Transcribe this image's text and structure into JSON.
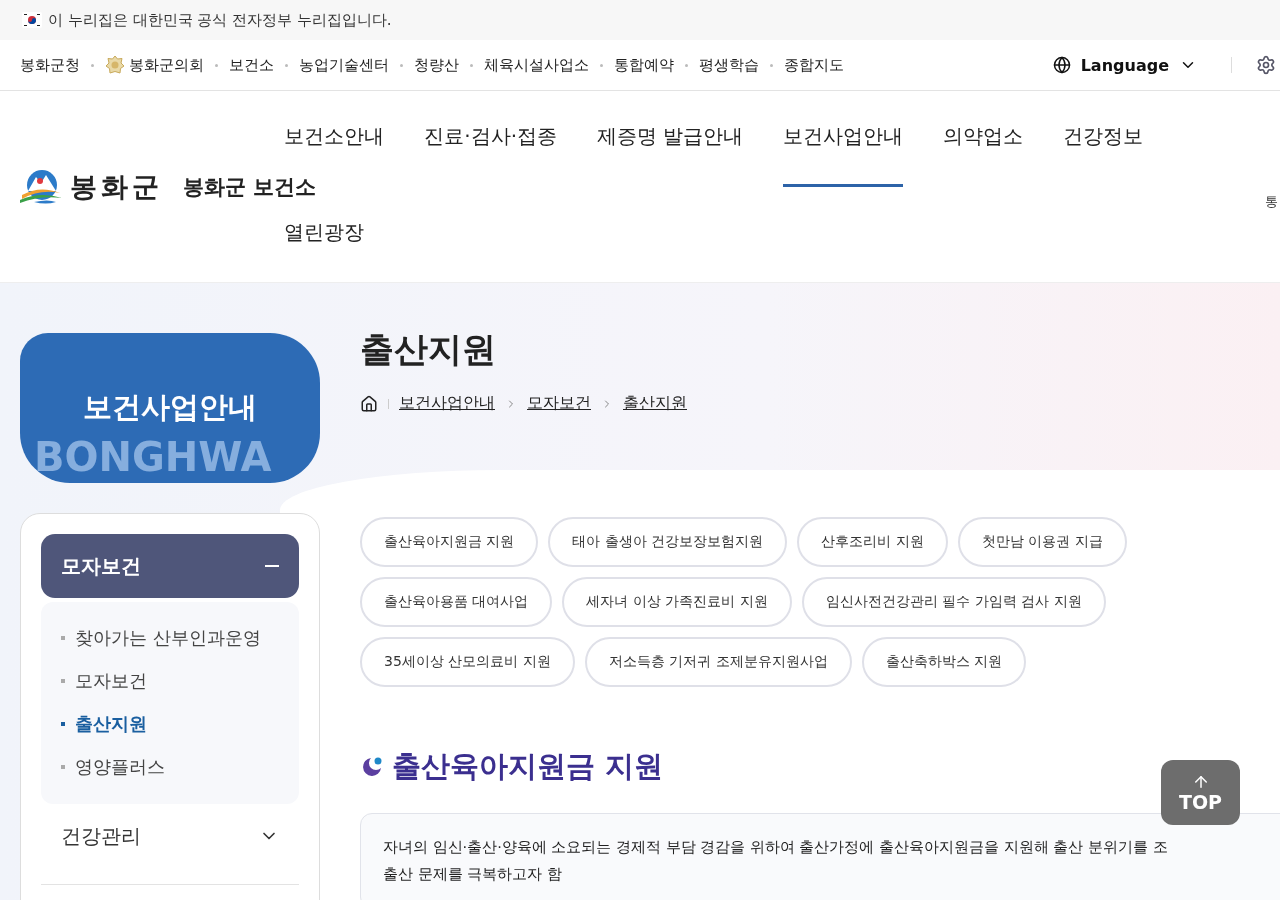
{
  "gov_banner": {
    "text": "이 누리집은 대한민국 공식 전자정부 누리집입니다."
  },
  "utility_nav": {
    "links": [
      {
        "label": "봉화군청",
        "kind": "text"
      },
      {
        "label": "봉화군의회",
        "kind": "emblem"
      },
      {
        "label": "보건소",
        "kind": "text"
      },
      {
        "label": "농업기술센터",
        "kind": "text"
      },
      {
        "label": "청량산",
        "kind": "text"
      },
      {
        "label": "체육시설사업소",
        "kind": "text"
      },
      {
        "label": "통합예약",
        "kind": "text"
      },
      {
        "label": "평생학습",
        "kind": "text"
      },
      {
        "label": "종합지도",
        "kind": "text"
      }
    ],
    "language": {
      "label": "Language"
    }
  },
  "header": {
    "logo_text": "봉화군",
    "site_name": "봉화군 보건소",
    "right_label": "통",
    "nav": [
      {
        "label": "보건소안내",
        "selected": false
      },
      {
        "label": "진료·검사·접종",
        "selected": false
      },
      {
        "label": "제증명 발급안내",
        "selected": false
      },
      {
        "label": "보건사업안내",
        "selected": true
      },
      {
        "label": "의약업소",
        "selected": false
      },
      {
        "label": "건강정보",
        "selected": false
      },
      {
        "label": "열린광장",
        "selected": false
      }
    ]
  },
  "sidebar": {
    "title": "보건사업안내",
    "background_text": "BONGHWA",
    "groups": [
      {
        "label": "모자보건",
        "expanded": true,
        "children": [
          {
            "label": "찾아가는 산부인과운영",
            "selected": false
          },
          {
            "label": "모자보건",
            "selected": false
          },
          {
            "label": "출산지원",
            "selected": true
          },
          {
            "label": "영양플러스",
            "selected": false
          }
        ]
      },
      {
        "label": "건강관리",
        "expanded": false
      }
    ]
  },
  "page": {
    "title": "출산지원",
    "breadcrumb": [
      "보건사업안내",
      "모자보건",
      "출산지원"
    ],
    "chips": [
      {
        "label": "출산육아지원금 지원"
      },
      {
        "label": "태아 출생아 건강보장보험지원"
      },
      {
        "label": "산후조리비 지원"
      },
      {
        "label": "첫만남 이용권 지급"
      },
      {
        "label": "출산육아용품 대여사업"
      },
      {
        "label": "세자녀 이상 가족진료비 지원"
      },
      {
        "label": "임신사전건강관리 필수 가임력 검사 지원"
      },
      {
        "label": "35세이상 산모의료비 지원"
      },
      {
        "label": "저소득층 기저귀 조제분유지원사업"
      },
      {
        "label": "출산축하박스 지원"
      }
    ],
    "section_title": "출산육아지원금 지원",
    "description": [
      "자녀의 임신·출산·양육에 소요되는 경제적 부담 경감을 위하여 출산가정에 출산육아지원금을 지원해 출산 분위기를 조",
      "출산 문제를 극복하고자 함"
    ]
  },
  "top_button": {
    "label": "TOP"
  }
}
